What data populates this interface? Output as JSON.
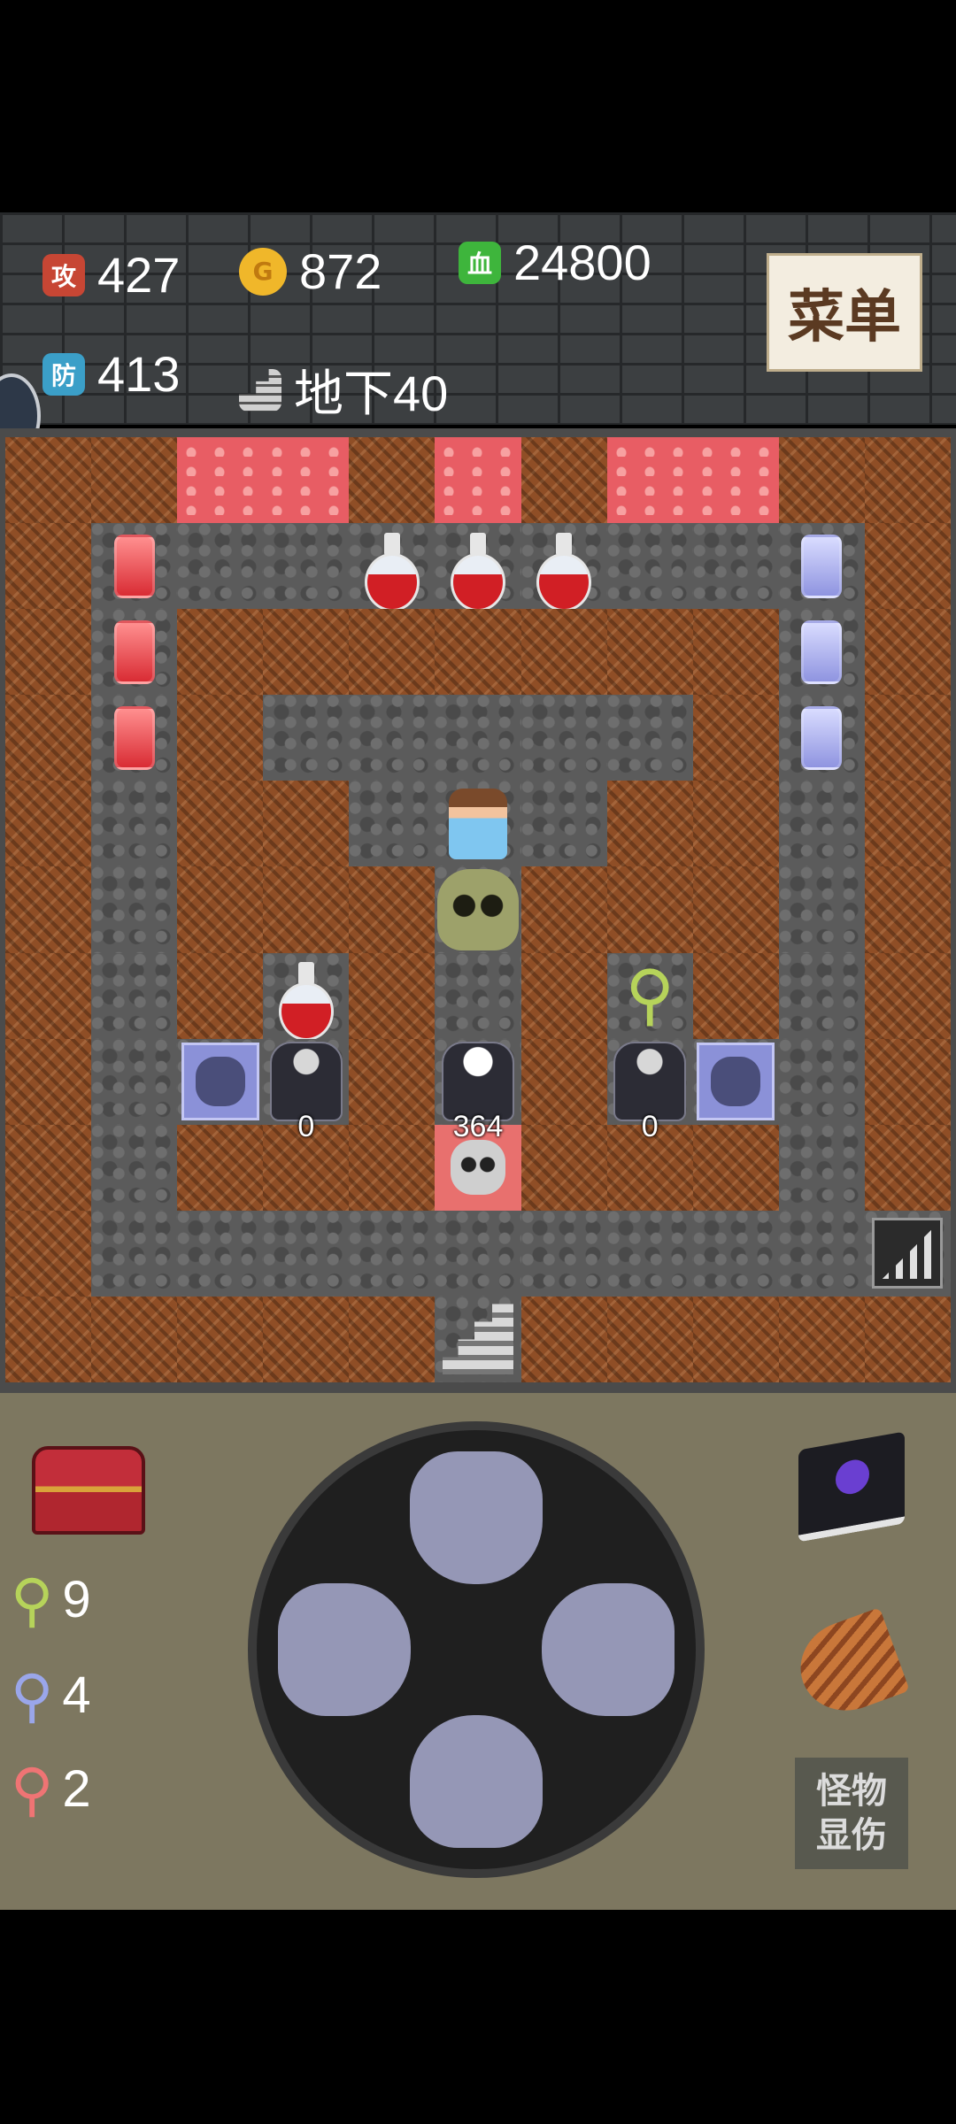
{
  "status": {
    "attack": {
      "icon_text": "攻",
      "value": "427"
    },
    "gold": {
      "icon_text": "G",
      "value": "872"
    },
    "hp": {
      "icon_text": "血",
      "value": "24800"
    },
    "defense": {
      "icon_text": "防",
      "value": "413"
    },
    "floor": {
      "value": "地下40"
    },
    "menu_label": "菜单"
  },
  "map": {
    "grid_size": 11,
    "rows": [
      [
        "wall",
        "wall",
        "lava",
        "lava",
        "wall",
        "lava",
        "wall",
        "lava",
        "lava",
        "wall",
        "wall"
      ],
      [
        "wall",
        "floor",
        "floor",
        "floor",
        "floor",
        "floor",
        "floor",
        "floor",
        "floor",
        "floor",
        "wall"
      ],
      [
        "wall",
        "floor",
        "wall",
        "wall",
        "wall",
        "wall",
        "wall",
        "wall",
        "wall",
        "floor",
        "wall"
      ],
      [
        "wall",
        "floor",
        "wall",
        "floor",
        "floor",
        "floor",
        "floor",
        "floor",
        "wall",
        "floor",
        "wall"
      ],
      [
        "wall",
        "floor",
        "wall",
        "wall",
        "floor",
        "floor",
        "floor",
        "wall",
        "wall",
        "floor",
        "wall"
      ],
      [
        "wall",
        "floor",
        "wall",
        "wall",
        "wall",
        "floor",
        "wall",
        "wall",
        "wall",
        "floor",
        "wall"
      ],
      [
        "wall",
        "floor",
        "wall",
        "floor",
        "wall",
        "floor",
        "wall",
        "floor",
        "wall",
        "floor",
        "wall"
      ],
      [
        "wall",
        "floor",
        "floor",
        "floor",
        "wall",
        "floor",
        "wall",
        "floor",
        "floor",
        "floor",
        "wall"
      ],
      [
        "wall",
        "floor",
        "wall",
        "wall",
        "wall",
        "floor",
        "wall",
        "wall",
        "wall",
        "floor",
        "wall"
      ],
      [
        "wall",
        "floor",
        "floor",
        "floor",
        "floor",
        "floor",
        "floor",
        "floor",
        "floor",
        "floor",
        "floor"
      ],
      [
        "wall",
        "wall",
        "wall",
        "wall",
        "wall",
        "floor",
        "wall",
        "wall",
        "wall",
        "wall",
        "wall"
      ]
    ],
    "entities": [
      {
        "row": 1,
        "col": 1,
        "kind": "red-gem"
      },
      {
        "row": 2,
        "col": 1,
        "kind": "red-gem"
      },
      {
        "row": 3,
        "col": 1,
        "kind": "red-gem"
      },
      {
        "row": 1,
        "col": 9,
        "kind": "blue-gem"
      },
      {
        "row": 2,
        "col": 9,
        "kind": "blue-gem"
      },
      {
        "row": 3,
        "col": 9,
        "kind": "blue-gem"
      },
      {
        "row": 1,
        "col": 4,
        "kind": "red-potion"
      },
      {
        "row": 1,
        "col": 5,
        "kind": "red-potion"
      },
      {
        "row": 1,
        "col": 6,
        "kind": "red-potion"
      },
      {
        "row": 4,
        "col": 5,
        "kind": "hero"
      },
      {
        "row": 5,
        "col": 5,
        "kind": "skull-monster"
      },
      {
        "row": 6,
        "col": 3,
        "kind": "red-potion"
      },
      {
        "row": 6,
        "col": 7,
        "kind": "yellow-key"
      },
      {
        "row": 7,
        "col": 2,
        "kind": "stone-face-block"
      },
      {
        "row": 7,
        "col": 3,
        "kind": "dark-knight",
        "damage": "0"
      },
      {
        "row": 7,
        "col": 5,
        "kind": "skeleton-knight",
        "damage": "364"
      },
      {
        "row": 7,
        "col": 7,
        "kind": "dark-knight",
        "damage": "0"
      },
      {
        "row": 7,
        "col": 8,
        "kind": "stone-face-block"
      },
      {
        "row": 8,
        "col": 5,
        "kind": "red-skull-monster"
      },
      {
        "row": 9,
        "col": 10,
        "kind": "stairs-up"
      },
      {
        "row": 10,
        "col": 5,
        "kind": "stairs-down"
      }
    ]
  },
  "keys": {
    "yellow": {
      "count": "9",
      "color": "#b6d35a"
    },
    "blue": {
      "count": "4",
      "color": "#9aa6ea"
    },
    "red": {
      "count": "2",
      "color": "#ef7474"
    }
  },
  "tools": {
    "monster_damage_label": "怪物\n显伤"
  }
}
